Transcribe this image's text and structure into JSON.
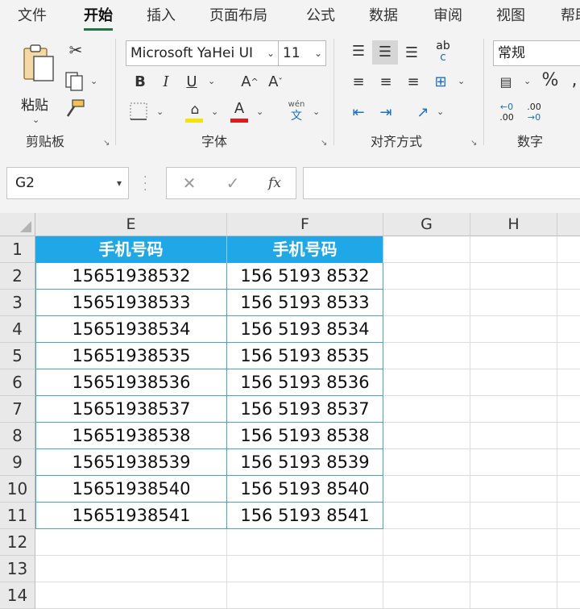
{
  "tabs": [
    "文件",
    "开始",
    "插入",
    "页面布局",
    "公式",
    "数据",
    "审阅",
    "视图",
    "帮助"
  ],
  "ribbon": {
    "clipboard": {
      "paste_label": "粘贴",
      "group_label": "剪贴板"
    },
    "font": {
      "name": "Microsoft YaHei UI",
      "size": "11",
      "bold": "B",
      "italic": "I",
      "underline": "U",
      "grow": "A",
      "shrink": "A",
      "font_color": "A",
      "phonetic_top": "wén",
      "phonetic_bottom": "文",
      "group_label": "字体",
      "fill_color": "#f5e400",
      "text_color": "#e01b1b"
    },
    "alignment": {
      "wrap_top": "ab",
      "wrap_bottom": "c",
      "group_label": "对齐方式"
    },
    "number": {
      "format": "常规",
      "percent": "%",
      "group_label": "数字",
      "inc_top": "←0",
      "inc_bottom": ".00",
      "dec_top": ".00",
      "dec_bottom": "→0"
    }
  },
  "formula_bar": {
    "name_box": "G2",
    "cancel": "✕",
    "enter": "✓",
    "fx": "fx",
    "formula": ""
  },
  "sheet": {
    "columns": [
      "E",
      "F",
      "G",
      "H"
    ],
    "rows": [
      "1",
      "2",
      "3",
      "4",
      "5",
      "6",
      "7",
      "8",
      "9",
      "10",
      "11",
      "12",
      "13",
      "14"
    ],
    "header_fill": "#1fa7e8",
    "header": [
      "手机号码",
      "手机号码"
    ],
    "data": [
      [
        "15651938532",
        "156 5193 8532"
      ],
      [
        "15651938533",
        "156 5193 8533"
      ],
      [
        "15651938534",
        "156 5193 8534"
      ],
      [
        "15651938535",
        "156 5193 8535"
      ],
      [
        "15651938536",
        "156 5193 8536"
      ],
      [
        "15651938537",
        "156 5193 8537"
      ],
      [
        "15651938538",
        "156 5193 8538"
      ],
      [
        "15651938539",
        "156 5193 8539"
      ],
      [
        "15651938540",
        "156 5193 8540"
      ],
      [
        "15651938541",
        "156 5193 8541"
      ]
    ]
  }
}
